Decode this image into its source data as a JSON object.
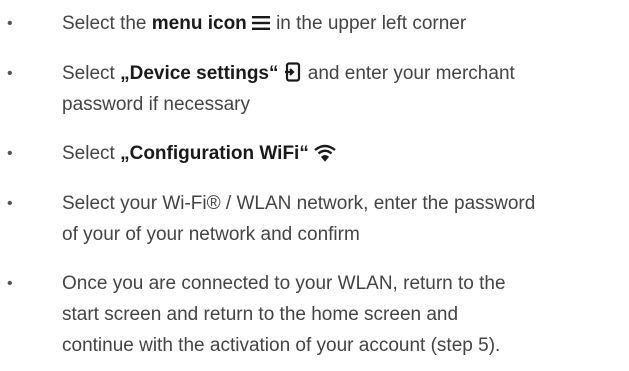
{
  "steps": [
    {
      "prefix": "Select the ",
      "bold": "menu icon",
      "icon": "menu-icon",
      "suffix": " in the upper left corner"
    },
    {
      "prefix": "Select ",
      "bold": "„Device settings“",
      "icon": "device-settings-icon",
      "suffix": " and enter your merchant",
      "line2": "password if necessary"
    },
    {
      "prefix": "Select ",
      "bold": "„Configuration WiFi“",
      "icon": "wifi-icon"
    },
    {
      "line1": "Select your Wi-Fi® / WLAN network, enter the password",
      "line2": "of your of your network and confirm"
    },
    {
      "line1": "Once you are connected to your WLAN, return to the",
      "line2": "start screen and return to the home screen and",
      "line3": "continue with the activation of your account (step 5)."
    }
  ],
  "bullet": "•",
  "colors": {
    "text": "#444444",
    "bold": "#1a1a1a"
  }
}
